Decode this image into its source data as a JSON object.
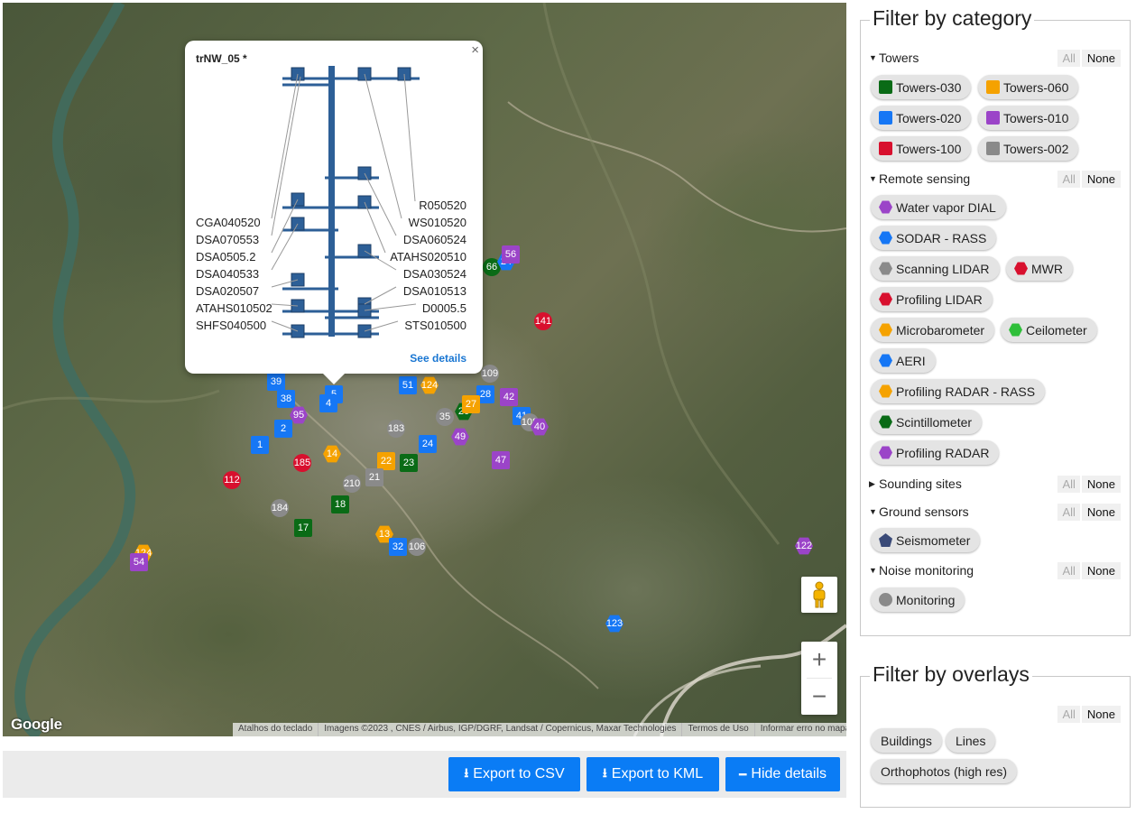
{
  "map": {
    "popup": {
      "title": "trNW_05 *",
      "close": "×",
      "see_details": "See details",
      "labels_left": [
        "CGA040520",
        "DSA070553",
        "DSA0505.2",
        "DSA040533",
        "DSA020507",
        "ATAHS010502",
        "SHFS040500"
      ],
      "labels_right": [
        "R050520",
        "WS010520",
        "DSA060524",
        "ATAHS020510",
        "DSA030524",
        "DSA010513",
        "D0005.5",
        "STS010500"
      ]
    },
    "google_logo": "Google",
    "attribution": [
      "Atalhos do teclado",
      "Imagens ©2023 , CNES / Airbus, IGP/DGRF, Landsat / Copernicus, Maxar Technologies",
      "Termos de Uso",
      "Informar erro no mapa"
    ],
    "zoom_in": "+",
    "zoom_out": "−",
    "markers": [
      "39",
      "38",
      "5",
      "4",
      "51",
      "124",
      "28",
      "42",
      "26",
      "27",
      "109",
      "95",
      "41",
      "108",
      "40",
      "183",
      "49",
      "2",
      "1",
      "185",
      "24",
      "22",
      "23",
      "47",
      "21",
      "18",
      "184",
      "17",
      "13",
      "32",
      "106",
      "124",
      "54",
      "141",
      "66",
      "24",
      "56",
      "122",
      "123",
      "112",
      "210",
      "35",
      "14"
    ]
  },
  "buttons": {
    "export_csv": "Export to CSV",
    "export_kml": "Export to KML",
    "hide_details": "Hide details"
  },
  "category_panel": {
    "title": "Filter by category",
    "all": "All",
    "none": "None",
    "sections": [
      {
        "name": "Towers",
        "expanded": true
      },
      {
        "name": "Remote sensing",
        "expanded": true
      },
      {
        "name": "Sounding sites",
        "expanded": false
      },
      {
        "name": "Ground sensors",
        "expanded": true
      },
      {
        "name": "Noise monitoring",
        "expanded": true
      }
    ],
    "chips": {
      "towers_030": "Towers-030",
      "towers_060": "Towers-060",
      "towers_020": "Towers-020",
      "towers_010": "Towers-010",
      "towers_100": "Towers-100",
      "towers_002": "Towers-002",
      "water_vapor_dial": "Water vapor DIAL",
      "sodar_rass": "SODAR - RASS",
      "scanning_lidar": "Scanning LIDAR",
      "mwr": "MWR",
      "profiling_lidar": "Profiling LIDAR",
      "microbarometer": "Microbarometer",
      "ceilometer": "Ceilometer",
      "aeri": "AERI",
      "profiling_radar_rass": "Profiling RADAR - RASS",
      "scintillometer": "Scintillometer",
      "profiling_radar": "Profiling RADAR",
      "seismometer": "Seismometer",
      "monitoring": "Monitoring"
    }
  },
  "overlay_panel": {
    "title": "Filter by overlays",
    "all": "All",
    "none": "None",
    "chips": {
      "buildings": "Buildings",
      "lines": "Lines",
      "orthophotos": "Orthophotos (high res)"
    }
  },
  "colors": {
    "towers_030": "#0a6b16",
    "towers_060": "#f5a200",
    "towers_020": "#1677f5",
    "towers_010": "#9b44c8",
    "towers_100": "#d8102e",
    "towers_002": "#8a8a8a",
    "button_blue": "#0a7cf5",
    "link_blue": "#1976d2",
    "mast_blue": "#2d5f97"
  }
}
